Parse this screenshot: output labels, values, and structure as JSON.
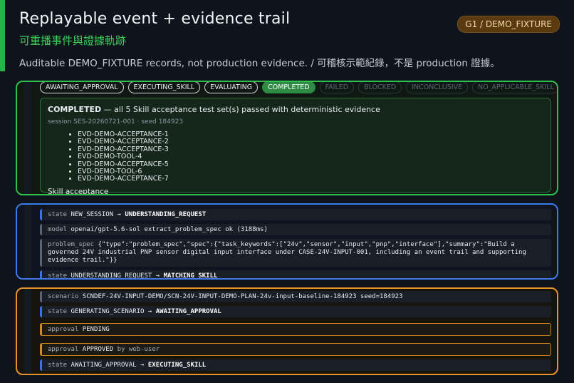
{
  "header": {
    "title": "Replayable event + evidence trail",
    "subtitle": "可重播事件與證據軌跡",
    "description": "Auditable DEMO_FIXTURE records, not production evidence. / 可稽核示範紀錄，不是 production 證據。",
    "badge": "G1 / DEMO_FIXTURE"
  },
  "status_chips": [
    {
      "label": "AWAITING_APPROVAL",
      "state": "active"
    },
    {
      "label": "EXECUTING_SKILL",
      "state": "active"
    },
    {
      "label": "EVALUATING",
      "state": "active"
    },
    {
      "label": "COMPLETED",
      "state": "done"
    },
    {
      "label": "FAILED",
      "state": "dim"
    },
    {
      "label": "BLOCKED",
      "state": "dim"
    },
    {
      "label": "INCONCLUSIVE",
      "state": "dim"
    },
    {
      "label": "NO_APPLICABLE_SKILL",
      "state": "dim"
    }
  ],
  "completed": {
    "status": "COMPLETED",
    "message": "— all 5 Skill acceptance test set(s) passed with deterministic evidence",
    "meta": "session SES-20260721-001 · seed 184923",
    "evidence": [
      "EVD-DEMO-ACCEPTANCE-1",
      "EVD-DEMO-ACCEPTANCE-2",
      "EVD-DEMO-ACCEPTANCE-3",
      "EVD-DEMO-TOOL-4",
      "EVD-DEMO-ACCEPTANCE-5",
      "EVD-DEMO-TOOL-6",
      "EVD-DEMO-ACCEPTANCE-7"
    ],
    "footer": "Skill acceptance"
  },
  "blue_rows": {
    "r1_key": "state",
    "r1_val": "NEW_SESSION →",
    "r1_strong": "UNDERSTANDING_REQUEST",
    "r2_key": "model",
    "r2_val": "openai/gpt-5.6-sol extract_problem_spec ok (3188ms)",
    "r3_key": "problem_spec",
    "r3_val": "{\"type\":\"problem_spec\",\"spec\":{\"task_keywords\":[\"24v\",\"sensor\",\"input\",\"pnp\",\"interface\"],\"summary\":\"Build a governed 24V industrial PNP sensor digital input interface under CASE-24V-INPUT-001, including an event trail and supporting evidence trail.\"}}",
    "r4_key": "state",
    "r4_val": "UNDERSTANDING_REQUEST →",
    "r4_strong": "MATCHING_SKILL"
  },
  "orange_rows": {
    "r1_key": "scenario",
    "r1_val": "SCNDEF-24V-INPUT-DEMO/SCN-24V-INPUT-DEMO-PLAN-24v-input-baseline-184923 seed=184923",
    "r2_key": "state",
    "r2_val": "GENERATING_SCENARIO →",
    "r2_strong": "AWAITING_APPROVAL",
    "r3_key": "approval",
    "r3_strong": "PENDING",
    "r4_key": "approval",
    "r4_strong": "APPROVED",
    "r4_val": "by web-user",
    "r5_key": "state",
    "r5_val": "AWAITING_APPROVAL →",
    "r5_strong": "EXECUTING_SKILL"
  },
  "colors": {
    "green_accent": "#2fbf4e",
    "blue_accent": "#3b7be8",
    "orange_accent": "#e8932a",
    "badge_bg": "#5a3a10"
  }
}
